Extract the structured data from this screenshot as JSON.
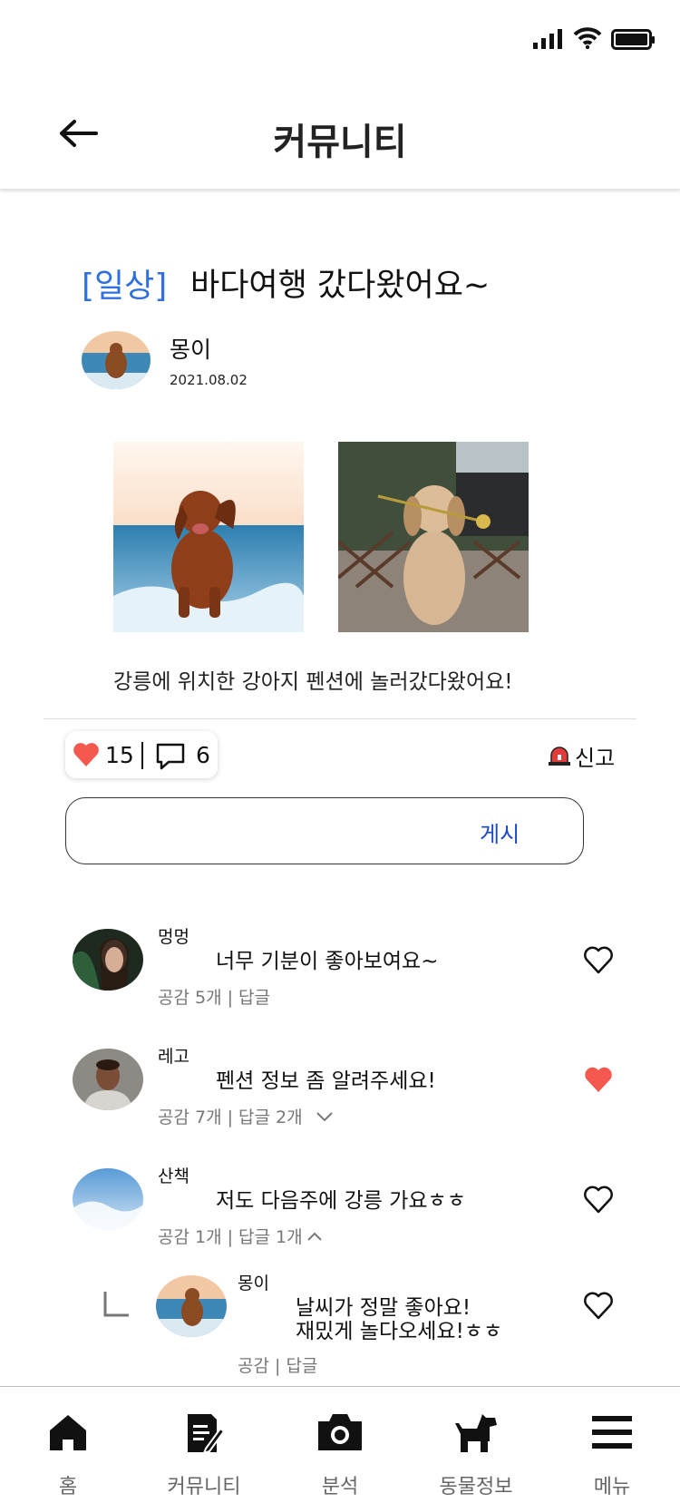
{
  "header": {
    "title": "커뮤니티"
  },
  "post": {
    "category": "[일상]",
    "title": "바다여행 갔다왔어요~",
    "author": "몽이",
    "date": "2021.08.02",
    "body": "강릉에 위치한 강아지 펜션에 놀러갔다왔어요!",
    "like_count": "15",
    "comment_count": "6",
    "report_label": "신고"
  },
  "comment_form": {
    "post_label": "게시",
    "value": ""
  },
  "comments": [
    {
      "name": "멍멍",
      "text": "너무 기분이 좋아보여요~",
      "meta": "공감 5개 | 답글",
      "liked": false
    },
    {
      "name": "레고",
      "text": "펜션 정보 좀 알려주세요!",
      "meta": "공감 7개 | 답글 2개",
      "liked": true
    },
    {
      "name": "산책",
      "text": "저도 다음주에 강릉 가요ㅎㅎ",
      "meta": "공감 1개 | 답글 1개",
      "liked": false
    }
  ],
  "reply": {
    "name": "몽이",
    "text_line1": "날씨가 정말 좋아요!",
    "text_line2": "재밌게 놀다오세요!ㅎㅎ",
    "meta": "공감 | 답글",
    "liked": false
  },
  "nav": [
    {
      "label": "홈",
      "icon": "home-icon"
    },
    {
      "label": "커뮤니티",
      "icon": "community-icon"
    },
    {
      "label": "분석",
      "icon": "camera-icon"
    },
    {
      "label": "동물정보",
      "icon": "dog-icon"
    },
    {
      "label": "메뉴",
      "icon": "menu-icon"
    }
  ],
  "colors": {
    "accent": "#2f6fe0",
    "post_button": "#1a49c9",
    "heart": "#f4584e"
  }
}
